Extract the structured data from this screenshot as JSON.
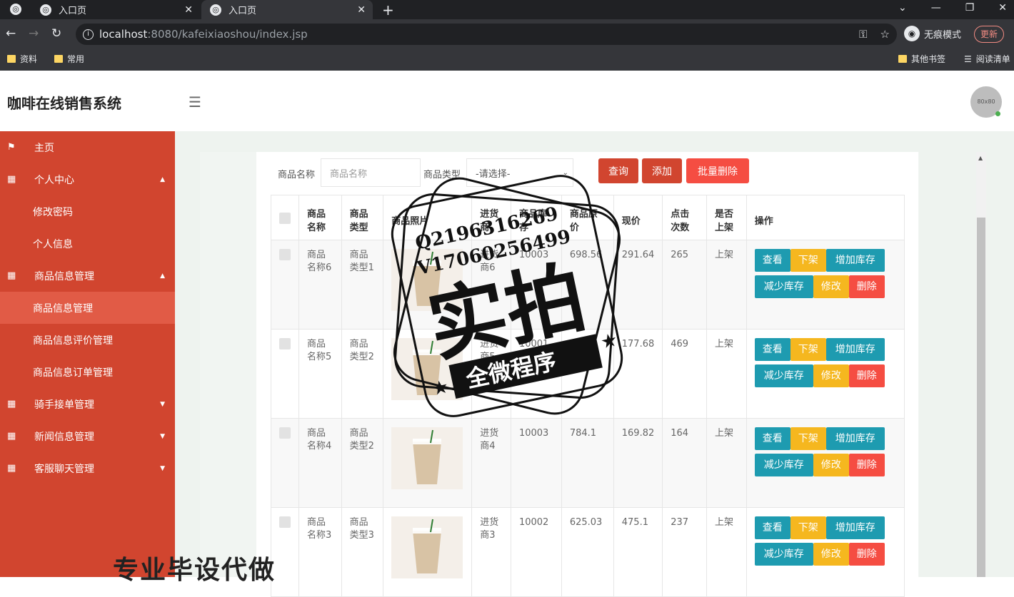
{
  "browser": {
    "tabs": [
      {
        "label": "入口页"
      },
      {
        "label": "入口页"
      }
    ],
    "url_host": "localhost",
    "url_path": ":8080/kafeixiaoshou/index.jsp",
    "incognito_label": "无痕模式",
    "update_label": "更新",
    "bookmarks": [
      "资料",
      "常用"
    ],
    "bookmarks_right": [
      "其他书签",
      "阅读清单"
    ]
  },
  "header": {
    "brand": "咖啡在线销售系统",
    "avatar_text": "80x80"
  },
  "sidebar": {
    "items": [
      {
        "label": "主页",
        "type": "top",
        "icon": "flag-icon"
      },
      {
        "label": "个人中心",
        "type": "top",
        "icon": "grid-icon",
        "caret": "up"
      },
      {
        "label": "修改密码",
        "type": "sub"
      },
      {
        "label": "个人信息",
        "type": "sub"
      },
      {
        "label": "商品信息管理",
        "type": "top",
        "icon": "grid-icon",
        "caret": "up"
      },
      {
        "label": "商品信息管理",
        "type": "sub",
        "active": true
      },
      {
        "label": "商品信息评价管理",
        "type": "sub"
      },
      {
        "label": "商品信息订单管理",
        "type": "sub"
      },
      {
        "label": "骑手接单管理",
        "type": "top",
        "icon": "grid-icon",
        "caret": "down"
      },
      {
        "label": "新闻信息管理",
        "type": "top",
        "icon": "grid-icon",
        "caret": "down"
      },
      {
        "label": "客服聊天管理",
        "type": "top",
        "icon": "grid-icon",
        "caret": "down"
      }
    ]
  },
  "search": {
    "name_label": "商品名称",
    "name_placeholder": "商品名称",
    "type_label": "商品类型",
    "type_selected": "-请选择-",
    "query_btn": "查询",
    "add_btn": "添加",
    "batch_delete_btn": "批量删除"
  },
  "table": {
    "headers": [
      "商品名称",
      "商品类型",
      "商品照片",
      "进货商",
      "商品库存",
      "商品原价",
      "现价",
      "点击次数",
      "是否上架",
      "操作"
    ],
    "rows": [
      {
        "name": "商品名称6",
        "type": "商品类型1",
        "supplier": "进货商6",
        "stock": "10003",
        "orig": "698.56",
        "price": "291.64",
        "clicks": "265",
        "status": "上架"
      },
      {
        "name": "商品名称5",
        "type": "商品类型2",
        "supplier": "进货商5",
        "stock": "10001",
        "orig": "",
        "price": "177.68",
        "clicks": "469",
        "status": "上架"
      },
      {
        "name": "商品名称4",
        "type": "商品类型2",
        "supplier": "进货商4",
        "stock": "10003",
        "orig": "784.1",
        "price": "169.82",
        "clicks": "164",
        "status": "上架"
      },
      {
        "name": "商品名称3",
        "type": "商品类型3",
        "supplier": "进货商3",
        "stock": "10002",
        "orig": "625.03",
        "price": "475.1",
        "clicks": "237",
        "status": "上架"
      }
    ],
    "actions": {
      "view": "查看",
      "off": "下架",
      "add_stock": "增加库存",
      "reduce_stock": "减少库存",
      "edit": "修改",
      "delete": "删除"
    }
  },
  "overlay": {
    "stamp_line1": "Q2196316269",
    "stamp_line2": "V17060256499",
    "stamp_big": "实拍",
    "stamp_banner": "全微程序",
    "bottom_watermark": "专业毕设代做"
  }
}
